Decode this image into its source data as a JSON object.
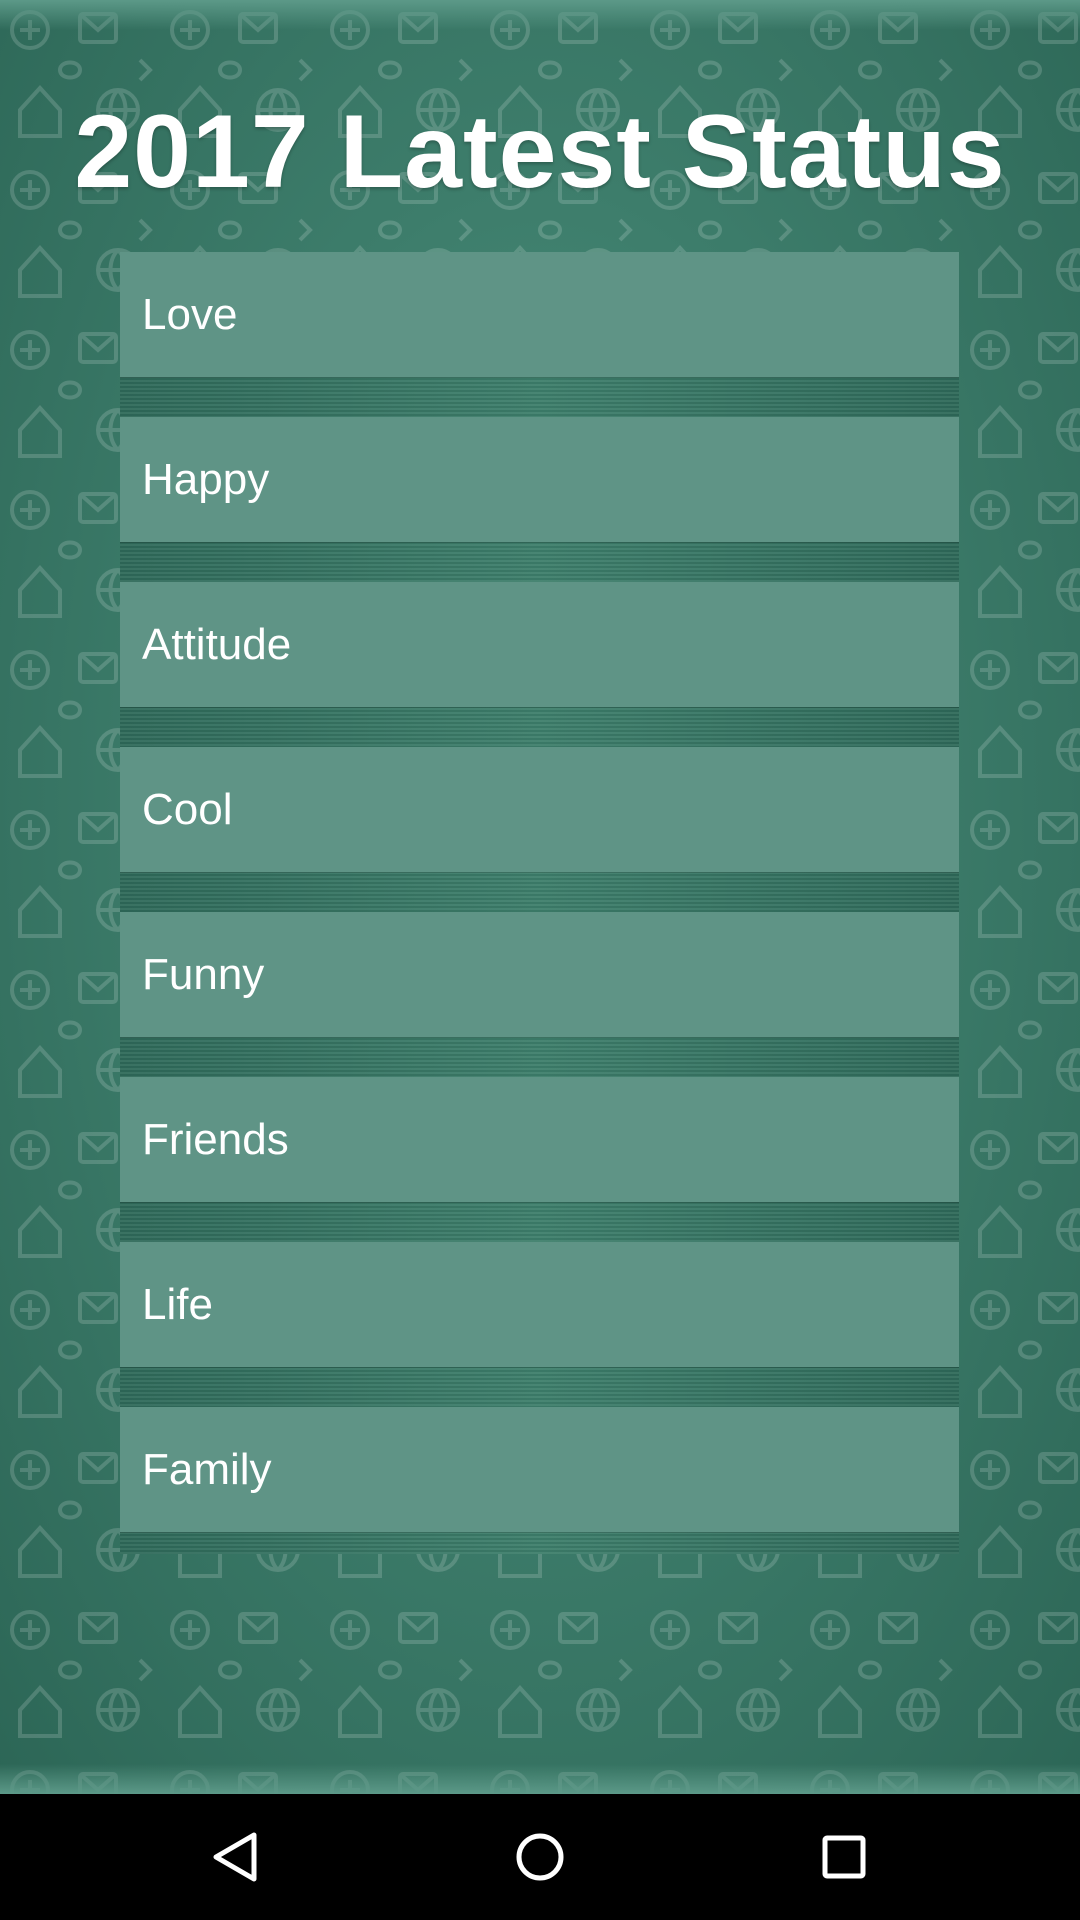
{
  "header": {
    "title": "2017 Latest Status"
  },
  "categories": [
    {
      "label": "Love"
    },
    {
      "label": "Happy"
    },
    {
      "label": "Attitude"
    },
    {
      "label": "Cool"
    },
    {
      "label": "Funny"
    },
    {
      "label": "Friends"
    },
    {
      "label": "Life"
    },
    {
      "label": "Family"
    }
  ],
  "navigation_bar": {
    "buttons": [
      "back-icon",
      "home-icon",
      "recents-icon"
    ]
  },
  "colors": {
    "background": "#3d7d6b",
    "item_background": "#5f9486",
    "text": "#ffffff",
    "nav_bar": "#000000"
  }
}
